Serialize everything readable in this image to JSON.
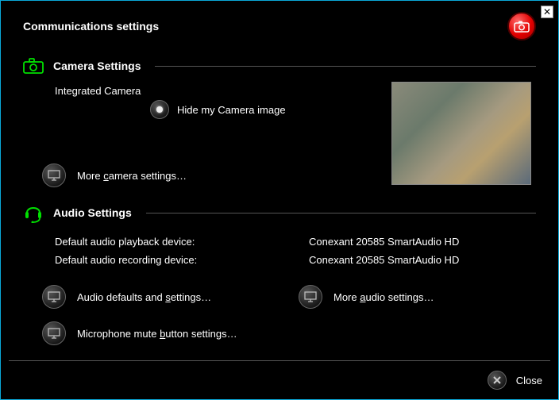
{
  "title": "Communications settings",
  "camera": {
    "heading": "Camera Settings",
    "device": "Integrated Camera",
    "hide_label": "Hide my Camera image",
    "hide_selected": true,
    "more": "More camera settings…"
  },
  "audio": {
    "heading": "Audio Settings",
    "playback_label": "Default audio playback device:",
    "playback_value": "Conexant 20585 SmartAudio HD",
    "recording_label": "Default audio recording device:",
    "recording_value": "Conexant 20585 SmartAudio HD",
    "defaults": "Audio defaults and settings…",
    "more": "More audio settings…",
    "mic": "Microphone mute button settings…"
  },
  "footer": {
    "close": "Close"
  }
}
